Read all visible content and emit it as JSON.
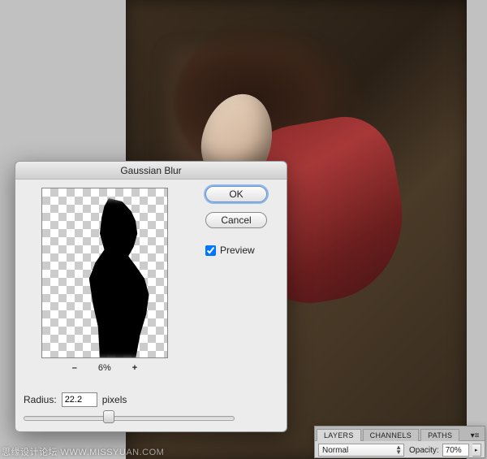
{
  "dialog": {
    "title": "Gaussian Blur",
    "ok_label": "OK",
    "cancel_label": "Cancel",
    "preview_label": "Preview",
    "preview_checked": true,
    "zoom_minus": "–",
    "zoom_value": "6%",
    "zoom_plus": "+",
    "radius_label": "Radius:",
    "radius_value": "22.2",
    "radius_unit": "pixels"
  },
  "layers_panel": {
    "tabs": [
      "LAYERS",
      "CHANNELS",
      "PATHS"
    ],
    "blend_mode": "Normal",
    "opacity_label": "Opacity:",
    "opacity_value": "70%"
  },
  "watermark": "思缘设计论坛  WWW.MISSYUAN.COM"
}
